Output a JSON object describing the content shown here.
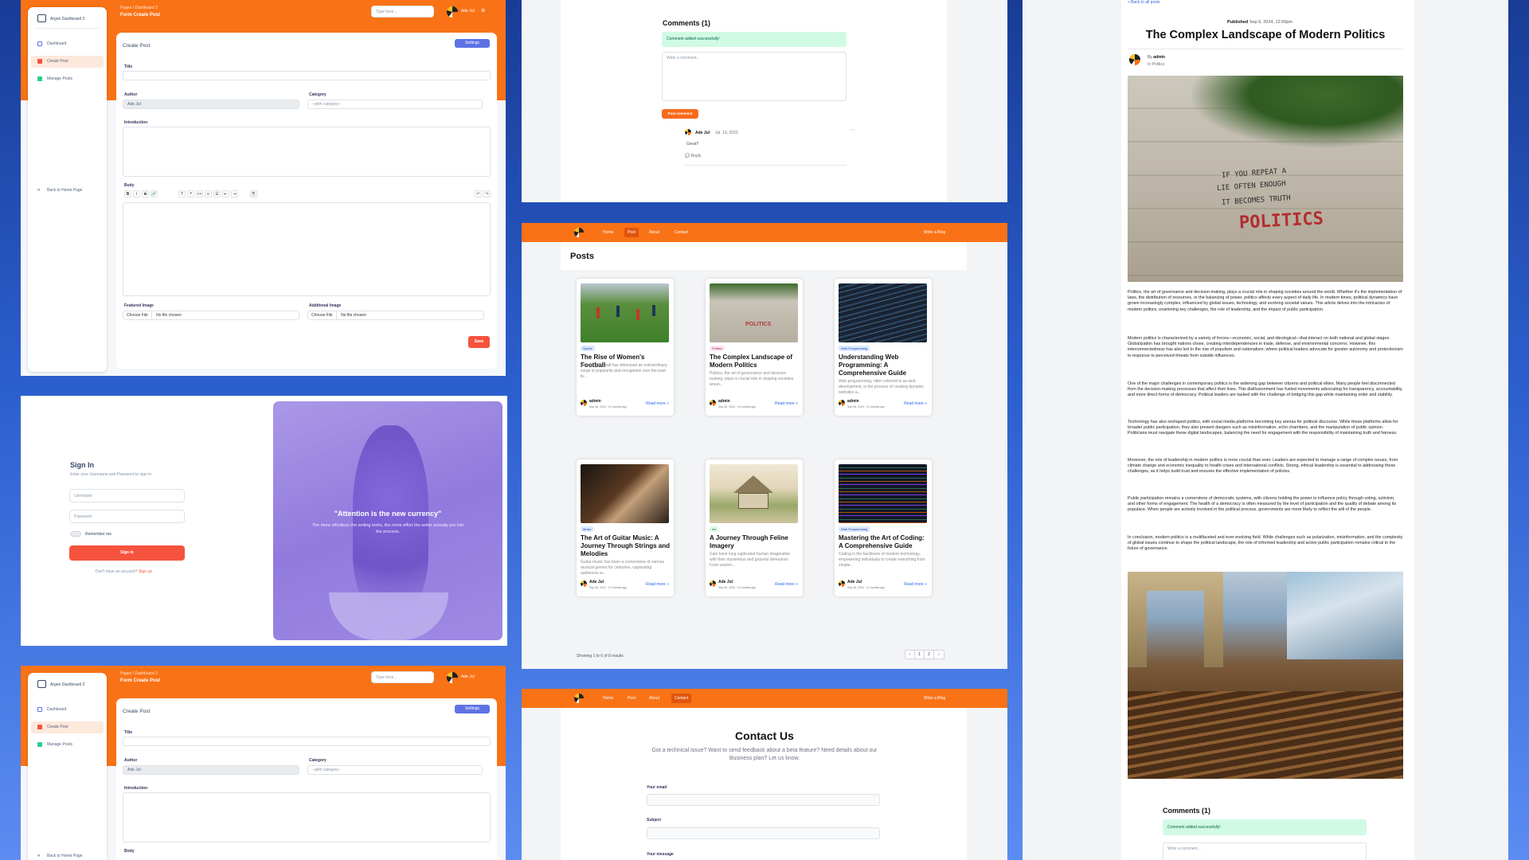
{
  "admin": {
    "breadcrumb": "Pages  /  Dashboard 2",
    "page_title": "Form Create Post",
    "search_placeholder": "Type here...",
    "user_name": "Ade Jul",
    "brand": "Argon Dashboard 2",
    "sidebar": [
      "Dashboard",
      "Create Post",
      "Manage Posts"
    ],
    "back_home": "Back to Home Page",
    "form_title": "Create Post",
    "settings_button": "Settings",
    "title_label": "Title",
    "author_label": "Author",
    "author_value": "Ade Jul",
    "category_label": "Category",
    "category_value": "--pilih category--",
    "intro_label": "Introduction",
    "body_label": "Body",
    "featured_label": "Featured Image",
    "additional_label": "Additional Image",
    "choose_file": "Choose File",
    "no_file": "No file chosen",
    "save_button": "Save",
    "toolbar": [
      "B",
      "I",
      "S",
      "🔗",
      "T",
      "❝",
      "<>",
      "≡",
      "☰",
      "⇤",
      "⇥",
      "⎘",
      "↶",
      "↷"
    ]
  },
  "signin": {
    "title": "Sign In",
    "subtitle": "Enter your Username and Password to sign in",
    "username_placeholder": "Username",
    "password_placeholder": "Password",
    "remember": "Remember me",
    "button": "Sign in",
    "no_account": "Don't have an account?",
    "signup": "Sign up",
    "quote": "\"Attention is the new currency\"",
    "quote_sub": "The more effortless the writing looks, the more effort the writer actually put into the process."
  },
  "comments_panel": {
    "title": "Comments (1)",
    "success": "Comment added successfully!",
    "placeholder": "Write a comment...",
    "post_button": "Post comment",
    "author": "Ade Jul",
    "date": "Jul. 10, 2023",
    "text": "Great!!",
    "reply": "Reply"
  },
  "blog_nav": {
    "items": [
      "Home",
      "Post",
      "About",
      "Contact"
    ],
    "write": "Write a Blog"
  },
  "posts_page": {
    "title": "Posts",
    "showing": "Showing 1 to 6 of 8 results",
    "pages": [
      "‹",
      "1",
      "2",
      "›"
    ],
    "read_more": "Read more »",
    "cards": [
      {
        "tag": "Sports",
        "tag_color": "#dbeafe",
        "title": "The Rise of Women's Football",
        "excerpt": "Women's football has witnessed an extraordinary surge in popularity and recognition over the past fe...",
        "author": "admin",
        "date": "Sep 06, 2024 · 10 months ago"
      },
      {
        "tag": "Politics",
        "tag_color": "#fce7f3",
        "title": "The Complex Landscape of Modern Politics",
        "excerpt": "Politics, the art of governance and decision-making, plays a crucial role in shaping societies aroun...",
        "author": "admin",
        "date": "Sep 06, 2024 · 10 months ago"
      },
      {
        "tag": "Web Programming",
        "tag_color": "#dbeafe",
        "title": "Understanding Web Programming: A Comprehensive Guide",
        "excerpt": "Web programming, often referred to as web development, is the process of creating dynamic websites a...",
        "author": "admin",
        "date": "Sep 06, 2024 · 10 months ago"
      },
      {
        "tag": "Music",
        "tag_color": "#dbeafe",
        "title": "The Art of Guitar Music: A Journey Through Strings and Melodies",
        "excerpt": "Guitar music has been a cornerstone of various musical genres for centuries, captivating audiences w...",
        "author": "Ade Jul",
        "date": "Sep 06, 2024 · 10 months ago"
      },
      {
        "tag": "Art",
        "tag_color": "#dcfce7",
        "title": "A Journey Through Feline Imagery",
        "excerpt": "Cats have long captivated human imagination with their mysterious and graceful demeanor. From ancien...",
        "author": "Ade Jul",
        "date": "Sep 06, 2024 · 10 months ago"
      },
      {
        "tag": "Web Programming",
        "tag_color": "#dbeafe",
        "title": "Mastering the Art of Coding: A Comprehensive Guide",
        "excerpt": "Coding is the backbone of modern technology, empowering individuals to create everything from simple...",
        "author": "Ade Jul",
        "date": "Sep 06, 2024 · 10 months ago"
      }
    ]
  },
  "contact": {
    "title": "Contact Us",
    "subtitle": "Got a technical issue? Want to send feedback about a beta feature? Need details about our Business plan? Let us know.",
    "email_label": "Your email",
    "subject_label": "Subject",
    "message_label": "Your message"
  },
  "article": {
    "back": "« Back to all posts",
    "published": "Published",
    "published_date": "Sep 6, 2024, 12:50pm",
    "title": "The Complex Landscape of Modern Politics",
    "by": "By",
    "author": "admin",
    "in_category": "In Politics",
    "image_text": [
      "IF YOU REPEAT A",
      "LIE OFTEN ENOUGH",
      "IT BECOMES TRUTH",
      "POLITICS"
    ],
    "paragraphs": [
      "Politics, the art of governance and decision-making, plays a crucial role in shaping societies around the world. Whether it's the implementation of laws, the distribution of resources, or the balancing of power, politics affects every aspect of daily life. In modern times, political dynamics have grown increasingly complex, influenced by global issues, technology, and evolving societal values. This article delves into the intricacies of modern politics, examining key challenges, the role of leadership, and the impact of public participation.",
      "Modern politics is characterized by a variety of forces—economic, social, and ideological—that interact on both national and global stages. Globalization has brought nations closer, creating interdependencies in trade, defense, and environmental concerns. However, this interconnectedness has also led to the rise of populism and nationalism, where political leaders advocate for greater autonomy and protectionism in response to perceived threats from outside influences.",
      "One of the major challenges in contemporary politics is the widening gap between citizens and political elites. Many people feel disconnected from the decision-making processes that affect their lives. This disillusionment has fueled movements advocating for transparency, accountability, and more direct forms of democracy. Political leaders are tasked with the challenge of bridging this gap while maintaining order and stability.",
      "Technology has also reshaped politics, with social media platforms becoming key arenas for political discourse. While these platforms allow for broader public participation, they also present dangers such as misinformation, echo chambers, and the manipulation of public opinion. Politicians must navigate these digital landscapes, balancing the need for engagement with the responsibility of maintaining truth and fairness.",
      "Moreover, the role of leadership in modern politics is more crucial than ever. Leaders are expected to manage a range of complex issues, from climate change and economic inequality to health crises and international conflicts. Strong, ethical leadership is essential to addressing these challenges, as it helps build trust and ensures the effective implementation of policies.",
      "Public participation remains a cornerstone of democratic systems, with citizens holding the power to influence policy through voting, activism, and other forms of engagement. The health of a democracy is often measured by the level of participation and the quality of debate among its populace. When people are actively involved in the political process, governments are more likely to reflect the will of the people.",
      "In conclusion, modern politics is a multifaceted and ever-evolving field. While challenges such as polarization, misinformation, and the complexity of global issues continue to shape the political landscape, the role of informed leadership and active public participation remains critical to the future of governance."
    ],
    "comments_title": "Comments (1)",
    "success": "Comment added successfully!",
    "placeholder": "Write a comment..."
  }
}
